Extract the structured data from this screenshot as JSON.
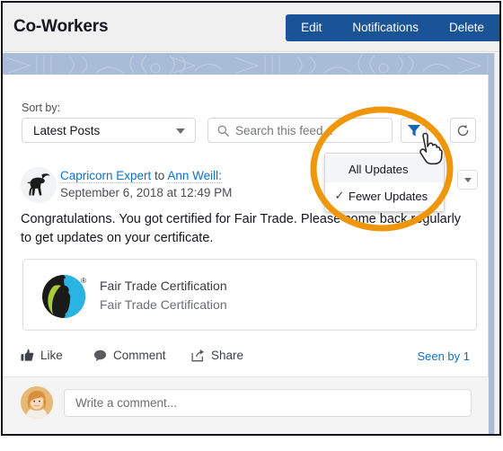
{
  "header": {
    "title": "Co-Workers",
    "buttons": [
      {
        "label": "Edit"
      },
      {
        "label": "Notifications"
      },
      {
        "label": "Delete"
      }
    ],
    "button_color": "#1a5497"
  },
  "banner": {
    "color": "#a8bcd7"
  },
  "toolbar": {
    "sort_label": "Sort by:",
    "sort_value": "Latest Posts",
    "search_placeholder": "Search this feed...",
    "filter_icon": "funnel-icon",
    "filter_icon_color": "#1667ba",
    "refresh_icon": "refresh-icon"
  },
  "dropdown": {
    "items": [
      {
        "label": "All Updates",
        "checked": false,
        "hovered": true
      },
      {
        "label": "Fewer Updates",
        "checked": true,
        "hovered": false
      }
    ],
    "check_glyph": "✓"
  },
  "post": {
    "author": "Capricorn Expert",
    "connector": " to ",
    "recipient": "Ann Weill:",
    "date": "September 6, 2018 at 12:49 PM",
    "body": "Congratulations. You got certified for Fair Trade. Please come back regularly to get updates on your certificate.",
    "avatar_icon": "capricorn-goat-avatar",
    "menu_icon": "chevron-down-icon",
    "attachment": {
      "title": "Fair Trade Certification",
      "subtitle": "Fair Trade Certification",
      "logo_icon": "fair-trade-logo",
      "logo_colors": {
        "cyan": "#29b4e3",
        "green": "#a9cb36",
        "black": "#1a1a18"
      }
    },
    "actions": [
      {
        "label": "Like",
        "icon": "thumbs-up-icon"
      },
      {
        "label": "Comment",
        "icon": "speech-bubble-icon"
      },
      {
        "label": "Share",
        "icon": "share-icon"
      }
    ],
    "seen_by": "Seen by 1"
  },
  "composer": {
    "placeholder": "Write a comment...",
    "avatar_icon": "woman-avatar"
  },
  "annotation": {
    "shape": "ellipse-highlight",
    "color": "#f0960a"
  },
  "cursor": {
    "icon": "pointing-hand-cursor"
  }
}
